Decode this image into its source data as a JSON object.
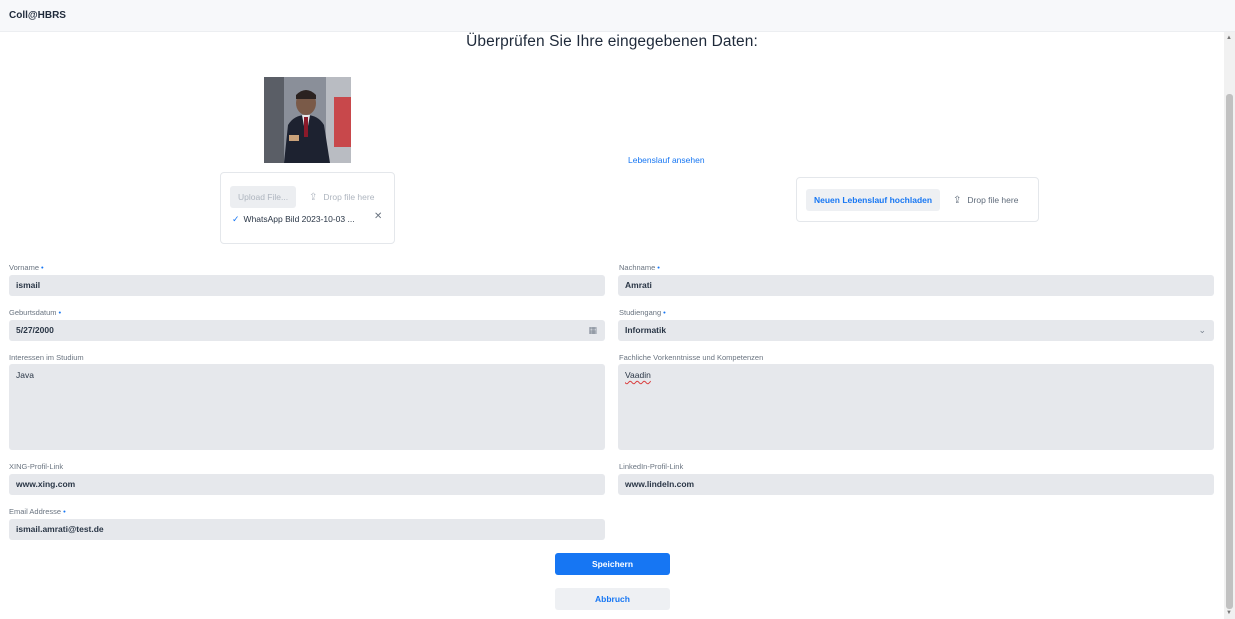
{
  "app": {
    "title": "Coll@HBRS"
  },
  "page": {
    "title": "Überprüfen Sie Ihre eingegebenen Daten:"
  },
  "photo_upload": {
    "button_label": "Upload File...",
    "drop_label": "Drop file here",
    "file_name": "WhatsApp Bild 2023-10-03 ..."
  },
  "cv": {
    "view_link": "Lebenslauf ansehen",
    "upload_label": "Neuen Lebenslauf hochladen",
    "drop_label": "Drop file here"
  },
  "form": {
    "vorname": {
      "label": "Vorname",
      "value": "ismail",
      "required": "•"
    },
    "nachname": {
      "label": "Nachname",
      "value": "Amrati",
      "required": "•"
    },
    "geburtsdatum": {
      "label": "Geburtsdatum",
      "value": "5/27/2000",
      "required": "•"
    },
    "studiengang": {
      "label": "Studiengang",
      "value": "Informatik",
      "required": "•"
    },
    "interessen": {
      "label": "Interessen im Studium",
      "value": "Java"
    },
    "vorkenntnisse": {
      "label": "Fachliche Vorkenntnisse und Kompetenzen",
      "value": "Vaadin"
    },
    "xing": {
      "label": "XING-Profil-Link",
      "value": "www.xing.com"
    },
    "linkedin": {
      "label": "LinkedIn-Profil-Link",
      "value": "www.lindeln.com"
    },
    "email": {
      "label": "Email Addresse",
      "value": "ismail.amrati@test.de",
      "required": "•"
    }
  },
  "actions": {
    "save_label": "Speichern",
    "cancel_label": "Abbruch"
  },
  "colors": {
    "accent": "#1676f3",
    "field_bg": "#e6e8ec"
  }
}
